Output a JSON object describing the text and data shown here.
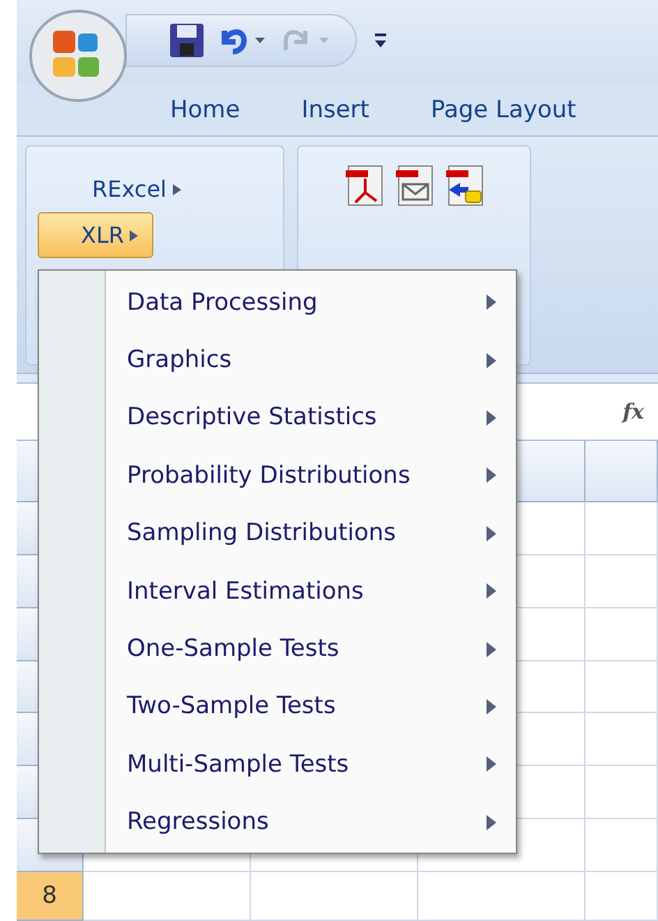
{
  "tabs": [
    {
      "label": "Home",
      "selected": false
    },
    {
      "label": "Insert",
      "selected": false
    },
    {
      "label": "Page Layout",
      "selected": false
    }
  ],
  "ribbon": {
    "rexcel_button": {
      "label": "RExcel"
    },
    "xlr_button": {
      "label": "XLR",
      "pressed": true
    }
  },
  "formula_bar": {
    "function_label": "fx"
  },
  "row_headers": [
    {
      "label": "8",
      "selected": true
    }
  ],
  "menu": {
    "items": [
      {
        "label": "Data Processing",
        "submenu": true
      },
      {
        "label": "Graphics",
        "submenu": true
      },
      {
        "label": "Descriptive Statistics",
        "submenu": true
      },
      {
        "label": "Probability Distributions",
        "submenu": true
      },
      {
        "label": "Sampling Distributions",
        "submenu": true
      },
      {
        "label": "Interval Estimations",
        "submenu": true
      },
      {
        "label": "One-Sample Tests",
        "submenu": true
      },
      {
        "label": "Two-Sample Tests",
        "submenu": true
      },
      {
        "label": "Multi-Sample Tests",
        "submenu": true
      },
      {
        "label": "Regressions",
        "submenu": true
      }
    ]
  }
}
